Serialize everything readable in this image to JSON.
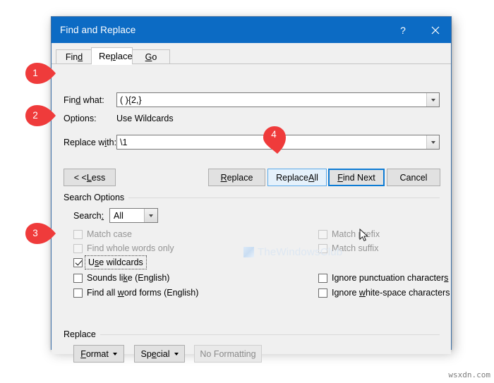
{
  "window": {
    "title": "Find and Replace",
    "help_icon": "question-mark-icon",
    "close_icon": "close-icon"
  },
  "tabs": [
    {
      "label": "Find",
      "accel": "d",
      "active": false
    },
    {
      "label": "Replace",
      "accel": "p",
      "active": true
    },
    {
      "label": "Go To",
      "accel": "G",
      "active": false
    }
  ],
  "fields": {
    "find_label": "Find what:",
    "find_value": "( ){2,}",
    "options_label": "Options:",
    "options_value": "Use Wildcards",
    "replace_label": "Replace with:",
    "replace_value": "\\1"
  },
  "buttons": {
    "less": "< < Less",
    "replace": "Replace",
    "replace_all": "Replace All",
    "find_next": "Find Next",
    "cancel": "Cancel"
  },
  "search_options": {
    "group_label": "Search Options",
    "search_label": "Search:",
    "search_value": "All",
    "left_checks": [
      {
        "label": "Match case",
        "checked": false,
        "disabled": true,
        "focused": false
      },
      {
        "label": "Find whole words only",
        "checked": false,
        "disabled": true,
        "focused": false
      },
      {
        "label": "Use wildcards",
        "checked": true,
        "disabled": false,
        "focused": true
      },
      {
        "label": "Sounds like (English)",
        "checked": false,
        "disabled": false,
        "focused": false
      },
      {
        "label": "Find all word forms (English)",
        "checked": false,
        "disabled": false,
        "focused": false
      }
    ],
    "right_checks": [
      {
        "label": "Match prefix",
        "checked": false,
        "disabled": true,
        "focused": false
      },
      {
        "label": "Match suffix",
        "checked": false,
        "disabled": true,
        "focused": false
      },
      {
        "label": "Ignore punctuation characters",
        "checked": false,
        "disabled": false,
        "focused": false
      },
      {
        "label": "Ignore white-space characters",
        "checked": false,
        "disabled": false,
        "focused": false
      }
    ]
  },
  "replace_group": {
    "group_label": "Replace",
    "format_button": "Format",
    "special_button": "Special",
    "no_formatting_button": "No Formatting"
  },
  "callouts": [
    {
      "number": "1"
    },
    {
      "number": "2"
    },
    {
      "number": "3"
    },
    {
      "number": "4"
    }
  ],
  "watermark": {
    "text": "TheWindowsClub"
  },
  "site_tag": "wsxdn.com",
  "colors": {
    "titlebar": "#0c6bc4",
    "dialog_bg": "#f0f0f0",
    "callout_red": "#ef3b3b",
    "default_button_border": "#0d7bd4",
    "hover_button_bg": "#e5f1fb"
  }
}
